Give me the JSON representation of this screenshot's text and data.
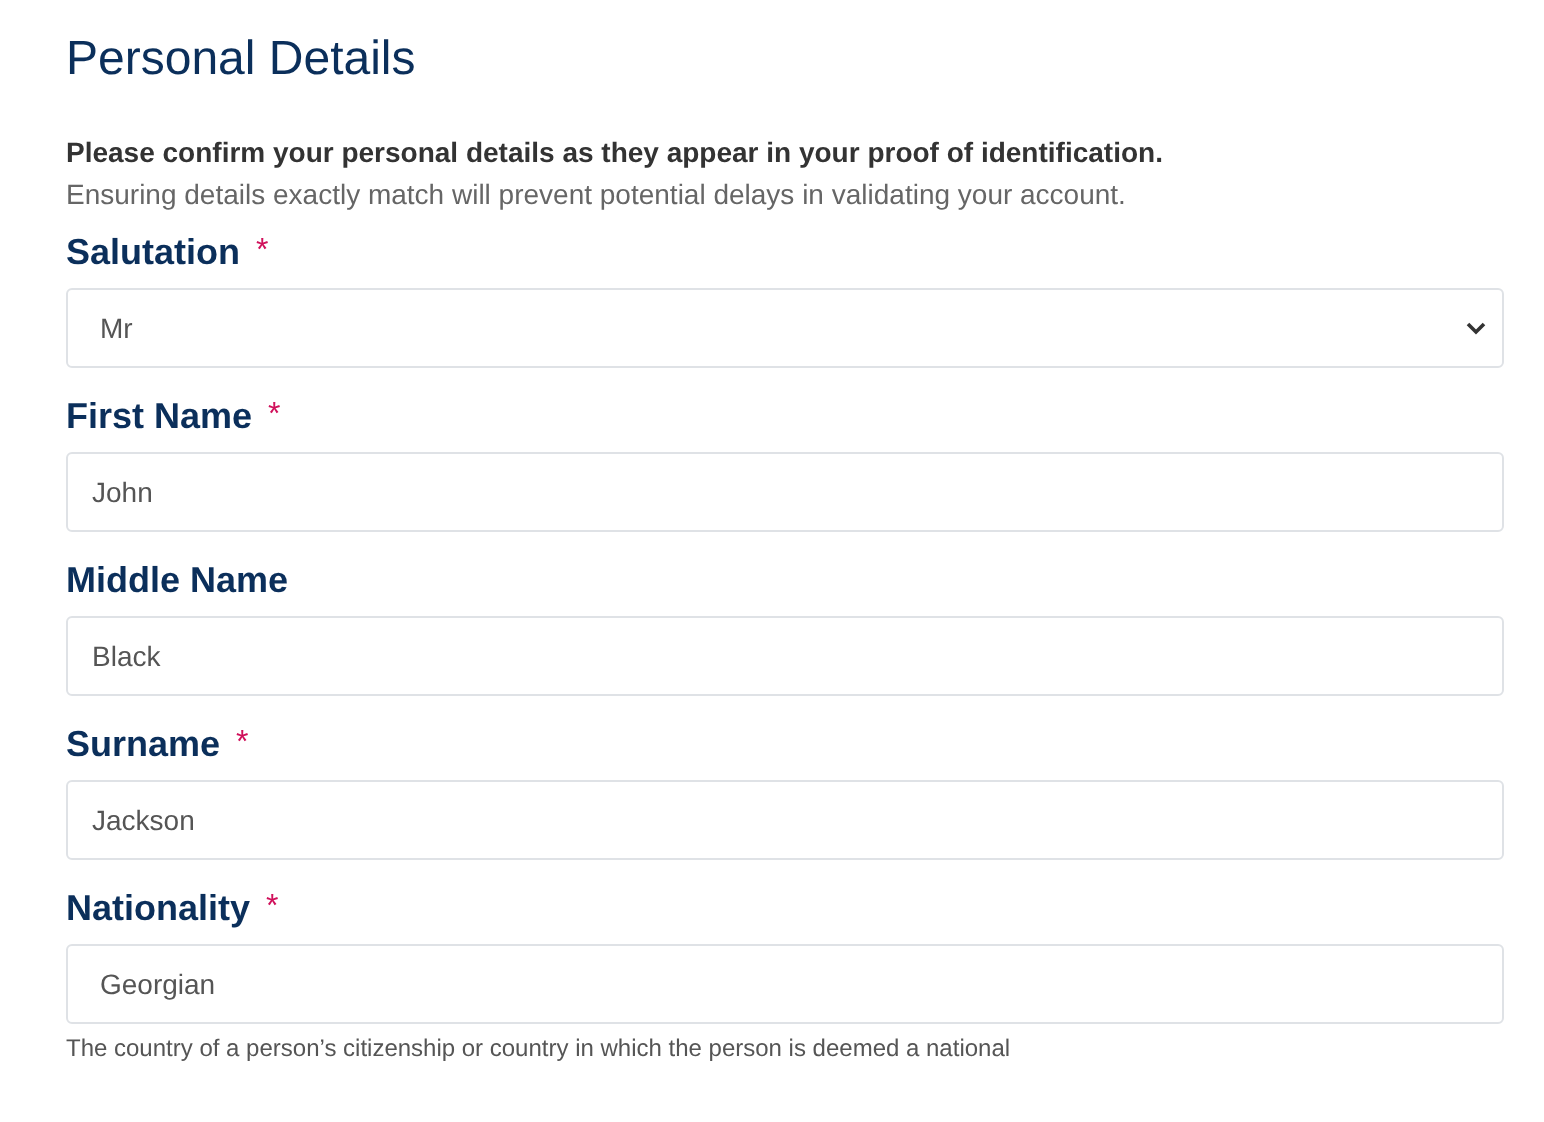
{
  "title": "Personal Details",
  "intro": {
    "lead": "Please confirm your personal details as they appear in your proof of identification.",
    "note": "Ensuring details exactly match will prevent potential delays in validating your account."
  },
  "fields": [
    {
      "label": "Salutation",
      "required_mark": "*",
      "kind": "select",
      "value": "Mr"
    },
    {
      "label": "First Name",
      "required_mark": "*",
      "kind": "text",
      "value": "John"
    },
    {
      "label": "Middle Name",
      "kind": "text",
      "value": "Black"
    },
    {
      "label": "Surname",
      "required_mark": "*",
      "kind": "text",
      "value": "Jackson"
    },
    {
      "label": "Nationality",
      "required_mark": "*",
      "kind": "combo",
      "value": "Georgian",
      "help": "The country of a person’s citizenship or country in which the person is deemed a national"
    }
  ]
}
